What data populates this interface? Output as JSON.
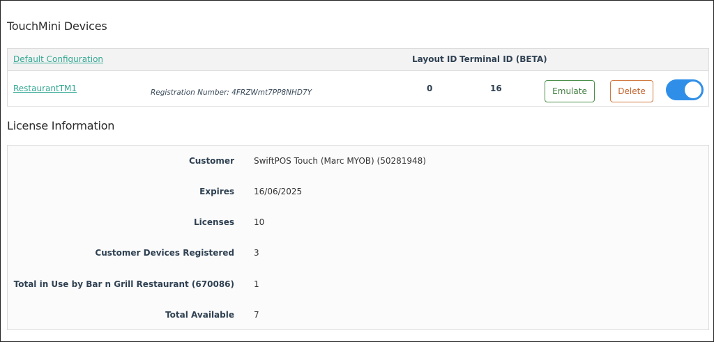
{
  "devices_section": {
    "title": "TouchMini Devices",
    "default_config_label": "Default Configuration",
    "columns": {
      "layout_id": "Layout ID",
      "terminal_id": "Terminal ID (BETA)"
    },
    "device": {
      "name": "RestaurantTM1",
      "registration": "Registration Number: 4FRZWmt7PP8NHD7Y",
      "layout_id": "0",
      "terminal_id": "16",
      "emulate_label": "Emulate",
      "delete_label": "Delete",
      "enabled": true
    }
  },
  "license_section": {
    "title": "License Information",
    "rows": [
      {
        "label": "Customer",
        "value": "SwiftPOS Touch (Marc MYOB) (50281948)"
      },
      {
        "label": "Expires",
        "value": "16/06/2025"
      },
      {
        "label": "Licenses",
        "value": "10"
      },
      {
        "label": "Customer Devices Registered",
        "value": "3"
      },
      {
        "label": "Total in Use by Bar n Grill Restaurant (670086)",
        "value": "1"
      },
      {
        "label": "Total Available",
        "value": "7"
      }
    ]
  },
  "colors": {
    "link": "#35a894",
    "toggle_on": "#2f8fe8",
    "emulate_border": "#4a8f4a",
    "delete_border": "#d0783f"
  }
}
